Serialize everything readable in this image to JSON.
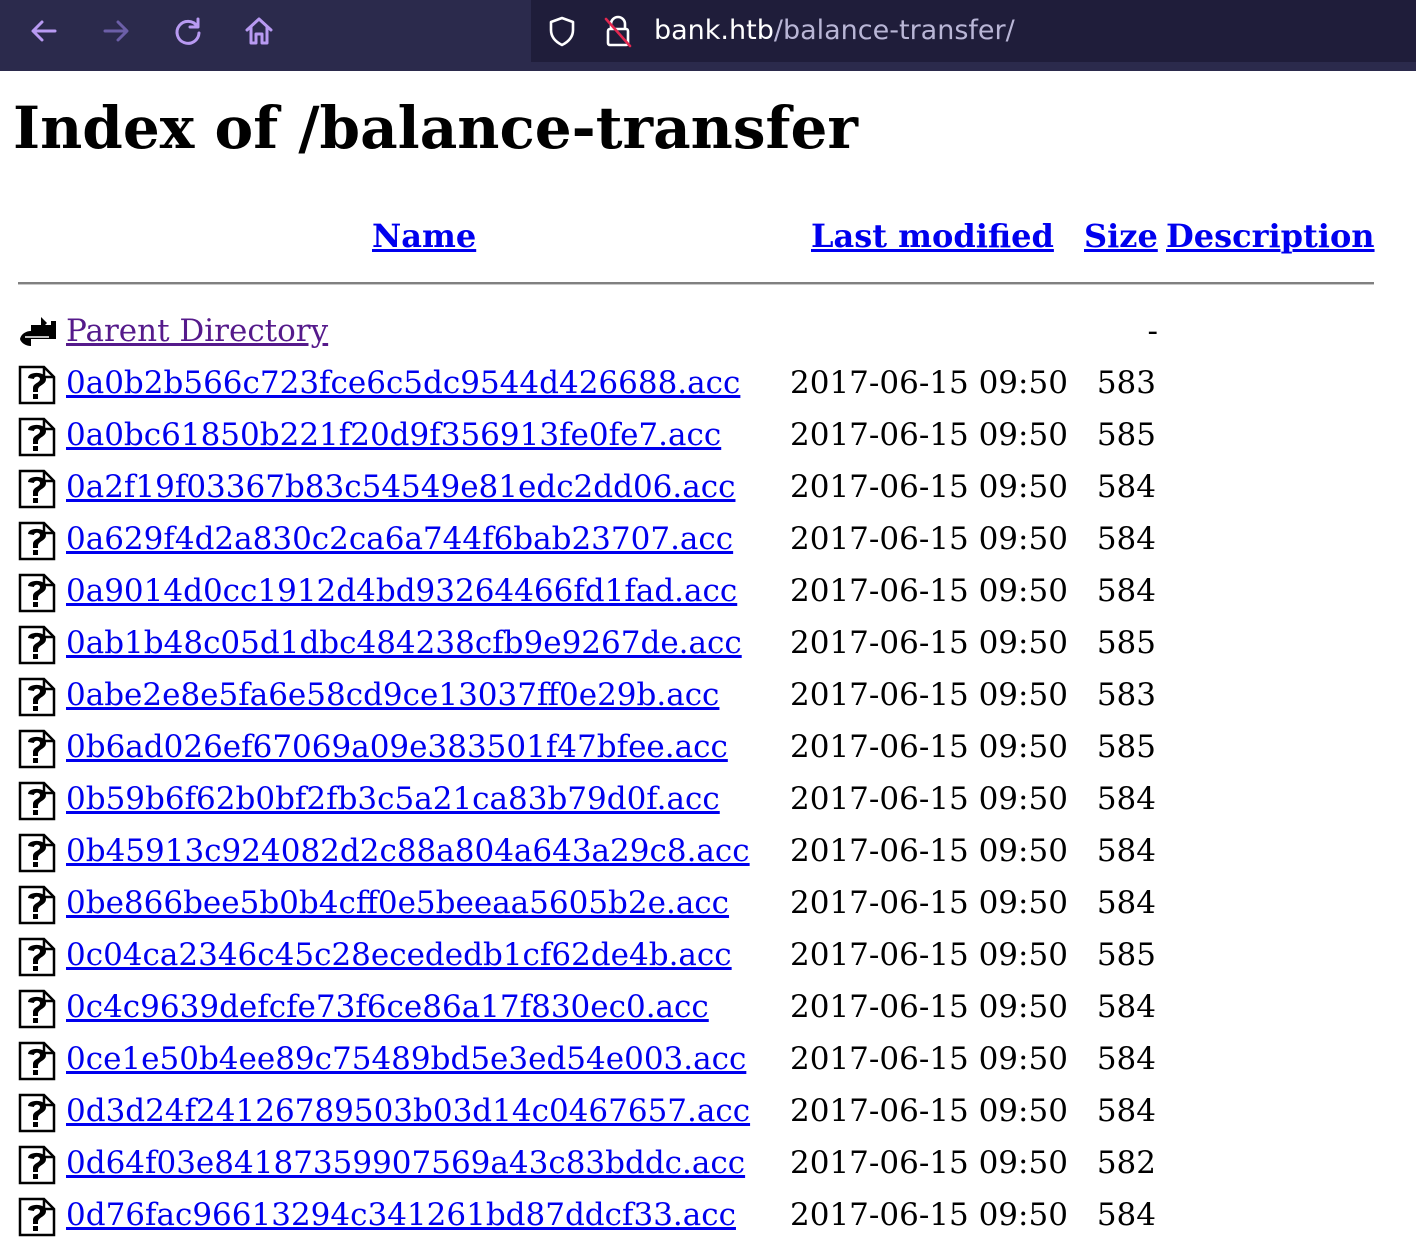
{
  "browser": {
    "url_host": "bank.htb",
    "url_path": "/balance-transfer/",
    "icons": [
      "back-arrow-icon",
      "forward-arrow-icon",
      "reload-icon",
      "home-icon",
      "shield-icon",
      "insecure-lock-icon"
    ]
  },
  "page": {
    "title": "Index of /balance-transfer",
    "headers": {
      "name": "Name",
      "last_modified": "Last modified",
      "size": "Size",
      "description": "Description"
    },
    "parent": {
      "label": "Parent Directory",
      "size": "-"
    },
    "files": [
      {
        "name": "0a0b2b566c723fce6c5dc9544d426688.acc",
        "modified": "2017-06-15 09:50",
        "size": "583"
      },
      {
        "name": "0a0bc61850b221f20d9f356913fe0fe7.acc",
        "modified": "2017-06-15 09:50",
        "size": "585"
      },
      {
        "name": "0a2f19f03367b83c54549e81edc2dd06.acc",
        "modified": "2017-06-15 09:50",
        "size": "584"
      },
      {
        "name": "0a629f4d2a830c2ca6a744f6bab23707.acc",
        "modified": "2017-06-15 09:50",
        "size": "584"
      },
      {
        "name": "0a9014d0cc1912d4bd93264466fd1fad.acc",
        "modified": "2017-06-15 09:50",
        "size": "584"
      },
      {
        "name": "0ab1b48c05d1dbc484238cfb9e9267de.acc",
        "modified": "2017-06-15 09:50",
        "size": "585"
      },
      {
        "name": "0abe2e8e5fa6e58cd9ce13037ff0e29b.acc",
        "modified": "2017-06-15 09:50",
        "size": "583"
      },
      {
        "name": "0b6ad026ef67069a09e383501f47bfee.acc",
        "modified": "2017-06-15 09:50",
        "size": "585"
      },
      {
        "name": "0b59b6f62b0bf2fb3c5a21ca83b79d0f.acc",
        "modified": "2017-06-15 09:50",
        "size": "584"
      },
      {
        "name": "0b45913c924082d2c88a804a643a29c8.acc",
        "modified": "2017-06-15 09:50",
        "size": "584"
      },
      {
        "name": "0be866bee5b0b4cff0e5beeaa5605b2e.acc",
        "modified": "2017-06-15 09:50",
        "size": "584"
      },
      {
        "name": "0c04ca2346c45c28ecededb1cf62de4b.acc",
        "modified": "2017-06-15 09:50",
        "size": "585"
      },
      {
        "name": "0c4c9639defcfe73f6ce86a17f830ec0.acc",
        "modified": "2017-06-15 09:50",
        "size": "584"
      },
      {
        "name": "0ce1e50b4ee89c75489bd5e3ed54e003.acc",
        "modified": "2017-06-15 09:50",
        "size": "584"
      },
      {
        "name": "0d3d24f24126789503b03d14c0467657.acc",
        "modified": "2017-06-15 09:50",
        "size": "584"
      },
      {
        "name": "0d64f03e84187359907569a43c83bddc.acc",
        "modified": "2017-06-15 09:50",
        "size": "582"
      },
      {
        "name": "0d76fac96613294c341261bd87ddcf33.acc",
        "modified": "2017-06-15 09:50",
        "size": "584"
      }
    ]
  },
  "colors": {
    "toolbar_bg": "#2b2a4c",
    "urlbar_bg": "#1f1d3a",
    "toolbar_icon": "#b89af2",
    "link": "#0000ee",
    "visited_link": "#551a8b"
  }
}
